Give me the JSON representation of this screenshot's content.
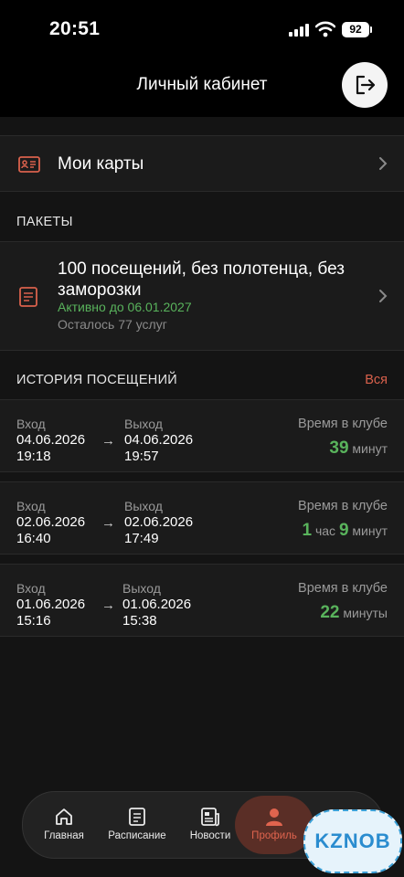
{
  "status_bar": {
    "time": "20:51",
    "battery": "92"
  },
  "header": {
    "title": "Личный кабинет"
  },
  "cards": {
    "label": "Мои карты"
  },
  "packets": {
    "section_title": "ПАКЕТЫ",
    "item": {
      "title": "100 посещений, без полотенца, без заморозки",
      "active_until": "Активно до 06.01.2027",
      "remaining": "Осталось 77 услуг"
    }
  },
  "history": {
    "section_title": "ИСТОРИЯ ПОСЕЩЕНИЙ",
    "all_link": "Вся",
    "in_label": "Вход",
    "out_label": "Выход",
    "duration_label": "Время в клубе",
    "visits": [
      {
        "in_date": "04.06.2026",
        "in_time": "19:18",
        "out_date": "04.06.2026",
        "out_time": "19:57",
        "hours": "",
        "hours_unit": "",
        "minutes": "39",
        "minutes_unit": "минут"
      },
      {
        "in_date": "02.06.2026",
        "in_time": "16:40",
        "out_date": "02.06.2026",
        "out_time": "17:49",
        "hours": "1",
        "hours_unit": "час",
        "minutes": "9",
        "minutes_unit": "минут"
      },
      {
        "in_date": "01.06.2026",
        "in_time": "15:16",
        "out_date": "01.06.2026",
        "out_time": "15:38",
        "hours": "",
        "hours_unit": "",
        "minutes": "22",
        "minutes_unit": "минуты"
      }
    ]
  },
  "tabbar": {
    "tabs": [
      {
        "label": "Главная",
        "icon": "home-icon"
      },
      {
        "label": "Расписание",
        "icon": "schedule-icon"
      },
      {
        "label": "Новости",
        "icon": "news-icon"
      },
      {
        "label": "Профиль",
        "icon": "profile-icon",
        "active": true
      }
    ]
  },
  "watermark": "KZNOB",
  "colors": {
    "accent": "#e0644e",
    "green": "#59b35c",
    "background": "#141414"
  }
}
